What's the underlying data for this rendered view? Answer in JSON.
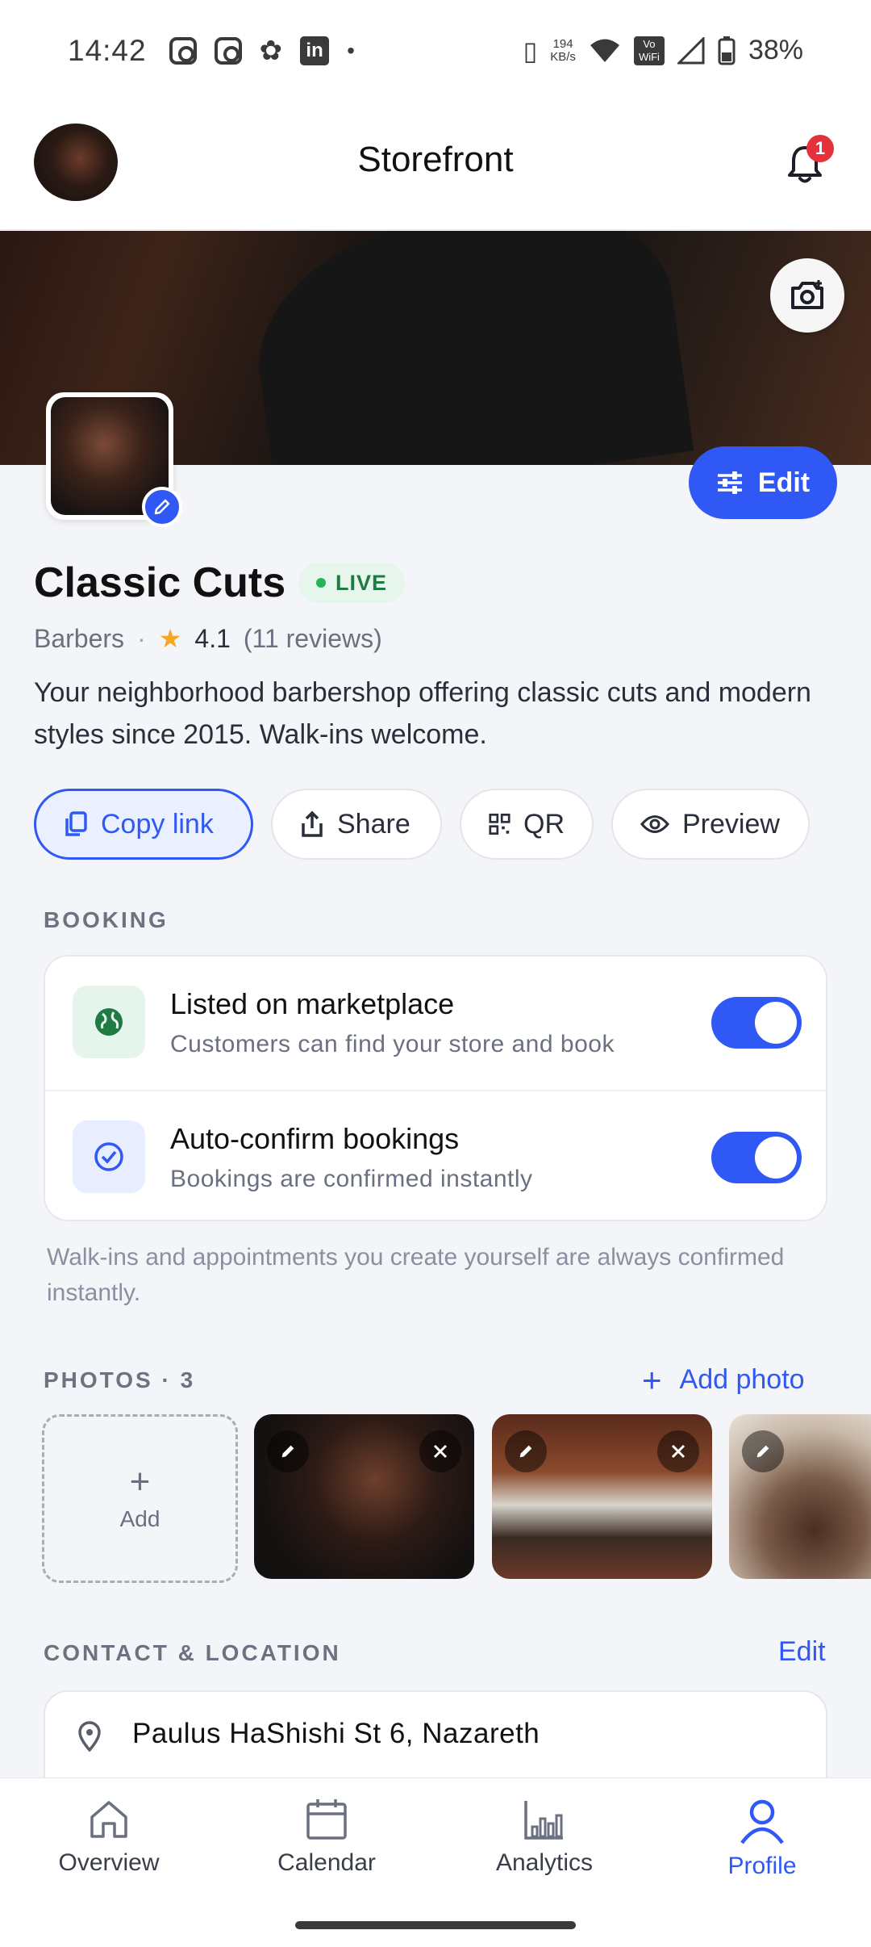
{
  "status_bar": {
    "time": "14:42",
    "net_speed": "194",
    "net_unit": "KB/s",
    "battery": "38%"
  },
  "header": {
    "title": "Storefront",
    "notification_count": "1"
  },
  "business": {
    "name": "Classic Cuts",
    "status": "LIVE",
    "category": "Barbers",
    "rating": "4.1",
    "reviews": "(11 reviews)",
    "description": "Your neighborhood barbershop offering classic cuts and modern styles since 2015. Walk-ins welcome.",
    "edit_label": "Edit"
  },
  "actions": {
    "copy_link": "Copy link",
    "share": "Share",
    "qr": "QR",
    "preview": "Preview"
  },
  "booking": {
    "label": "BOOKING",
    "rows": [
      {
        "title": "Listed on marketplace",
        "subtitle": "Customers can find your store and book",
        "enabled": true
      },
      {
        "title": "Auto-confirm bookings",
        "subtitle": "Bookings are confirmed instantly",
        "enabled": true
      }
    ],
    "note": "Walk-ins and appointments you create yourself are always confirmed instantly."
  },
  "photos": {
    "label": "PHOTOS · 3",
    "add_photo": "Add photo",
    "add_tile": "Add"
  },
  "contact": {
    "label": "CONTACT & LOCATION",
    "edit": "Edit",
    "address": "Paulus HaShishi St 6, Nazareth"
  },
  "nav": {
    "items": [
      "Overview",
      "Calendar",
      "Analytics",
      "Profile"
    ],
    "active": "Profile"
  },
  "colors": {
    "accent": "#2F58F5",
    "live_bg": "#E7F6EC",
    "live_text": "#1F7A44",
    "badge": "#E4313B"
  }
}
